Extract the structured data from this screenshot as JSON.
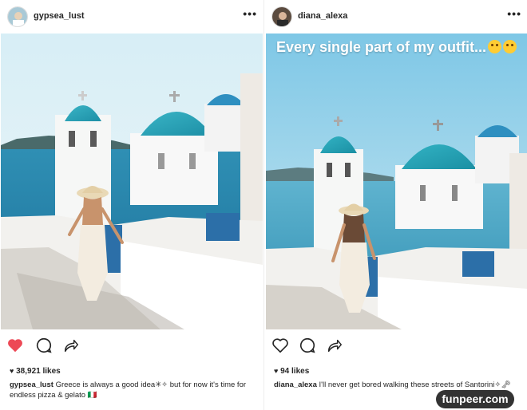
{
  "posts": [
    {
      "username": "gypsea_lust",
      "likes": "38,921 likes",
      "caption_user": "gypsea_lust",
      "caption_text": "Greece is always a good idea✳✧ but for now it's time for endless pizza & gelato 🇮🇹",
      "liked": true,
      "colors": {
        "like_red": "#ed4956"
      }
    },
    {
      "username": "diana_alexa",
      "story_text": "Every single part of my outfit...",
      "likes": "94 likes",
      "caption_user": "diana_alexa",
      "caption_text": "I'll never get bored walking these streets of Santorini✧🗝",
      "liked": false
    }
  ],
  "watermark": "funpeer.com",
  "icons": [
    "more-icon",
    "heart-icon",
    "comment-icon",
    "share-icon"
  ]
}
